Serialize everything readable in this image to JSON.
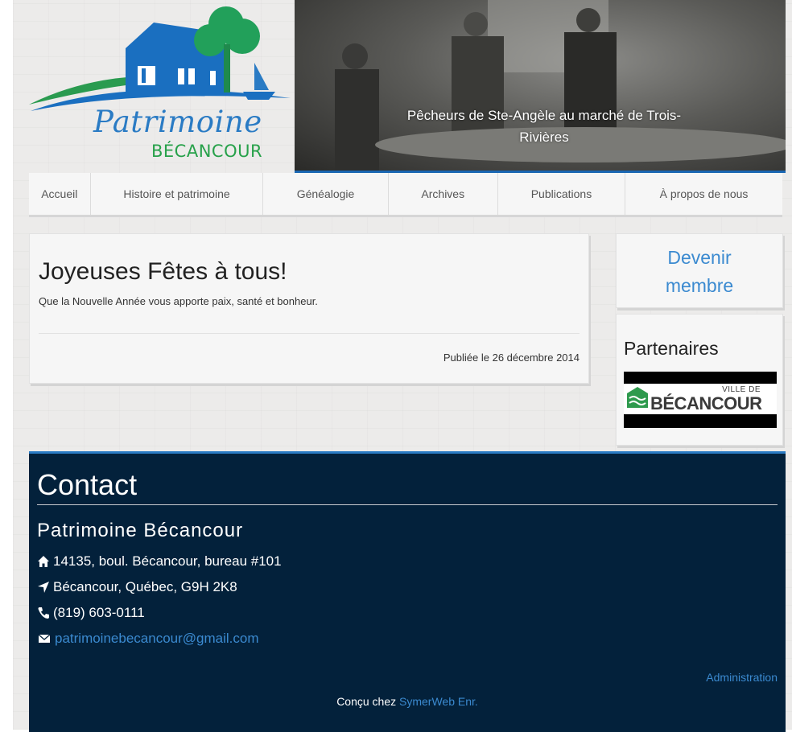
{
  "header": {
    "logo_script": "Patrimoine",
    "logo_sub": "BÉCANCOUR",
    "banner_caption": "Pêcheurs de Ste-Angèle au marché de Trois-Rivières"
  },
  "nav": {
    "items": [
      {
        "label": "Accueil"
      },
      {
        "label": "Histoire et patrimoine"
      },
      {
        "label": "Généalogie"
      },
      {
        "label": "Archives"
      },
      {
        "label": "Publications"
      },
      {
        "label": "À propos de nous"
      }
    ]
  },
  "article": {
    "title": "Joyeuses Fêtes à tous!",
    "text": "Que la Nouvelle Année vous apporte paix, santé et bonheur.",
    "date": "Publiée le 26 décembre 2014"
  },
  "sidebar": {
    "member_line1": "Devenir",
    "member_line2": "membre",
    "partners_title": "Partenaires",
    "partner_ville": "VILLE DE",
    "partner_name": "BÉCANCOUR"
  },
  "footer": {
    "title": "Contact",
    "org": "Patrimoine Bécancour",
    "address": "14135, boul. Bécancour, bureau #101",
    "city": "Bécancour, Québec, G9H 2K8",
    "phone": "(819) 603-0111",
    "email": "patrimoinebecancour@gmail.com",
    "admin": "Administration",
    "credit_prefix": "Conçu chez",
    "credit_link": "SymerWeb Enr."
  },
  "colors": {
    "accent_blue": "#2a7bc4",
    "link_blue": "#3b8ad0",
    "footer_bg": "#03213b",
    "logo_green": "#27a14a"
  },
  "icons": [
    "home-icon",
    "location-arrow-icon",
    "phone-icon",
    "envelope-icon"
  ]
}
